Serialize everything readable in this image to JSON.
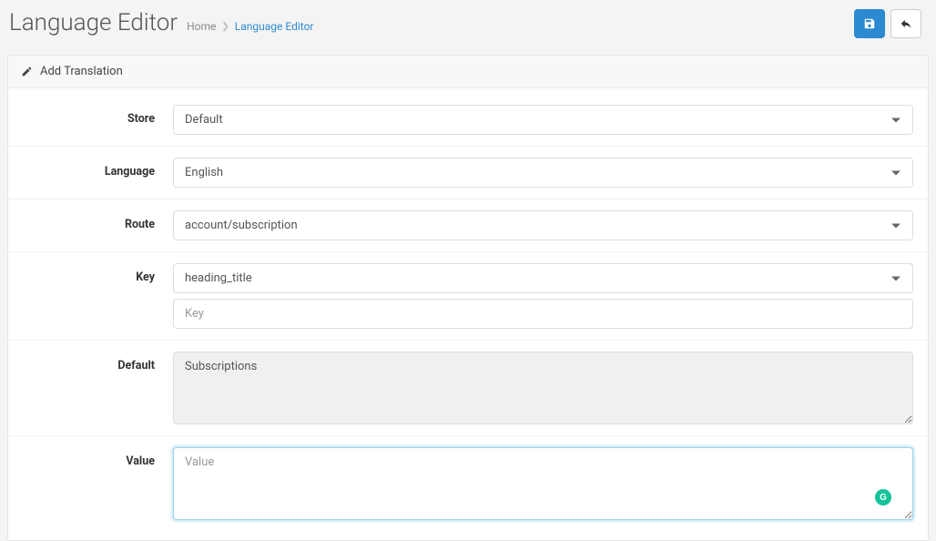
{
  "header": {
    "title": "Language Editor",
    "breadcrumb": {
      "home": "Home",
      "current": "Language Editor"
    }
  },
  "panel": {
    "title": "Add Translation"
  },
  "form": {
    "store": {
      "label": "Store",
      "value": "Default"
    },
    "language": {
      "label": "Language",
      "value": "English"
    },
    "route": {
      "label": "Route",
      "value": "account/subscription"
    },
    "key": {
      "label": "Key",
      "select_value": "heading_title",
      "input_placeholder": "Key",
      "input_value": ""
    },
    "default": {
      "label": "Default",
      "value": "Subscriptions"
    },
    "value": {
      "label": "Value",
      "placeholder": "Value",
      "value": ""
    }
  }
}
